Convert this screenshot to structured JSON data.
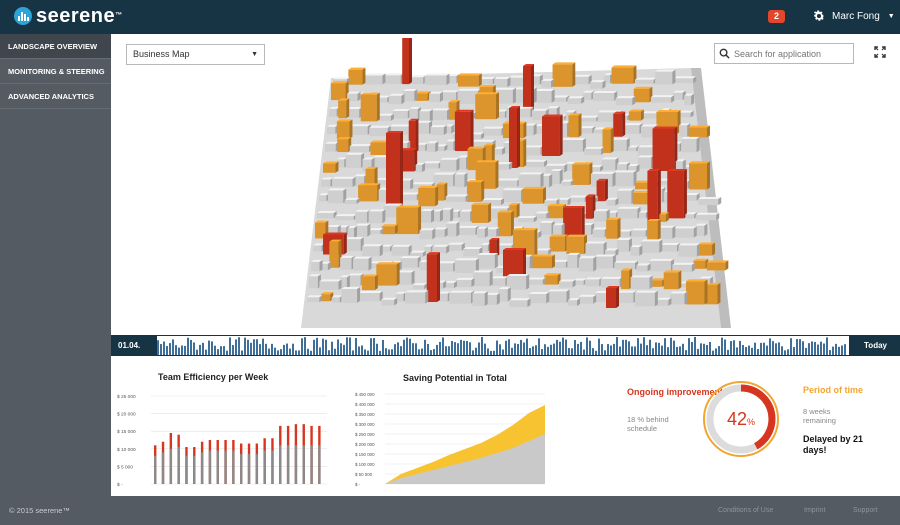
{
  "header": {
    "logo_text": "seerene",
    "logo_tm": "™",
    "notifications": "2",
    "user_name": "Marc Fong",
    "colors": {
      "bar": "#173445",
      "accent": "#2ea3d6",
      "badge": "#e4462b"
    }
  },
  "sidebar": {
    "items": [
      {
        "label": "LANDSCAPE OVERVIEW"
      },
      {
        "label": "MONITORING & STEERING"
      },
      {
        "label": "ADVANCED ANALYTICS"
      }
    ]
  },
  "map": {
    "view_selector": "Business Map",
    "search_placeholder": "Search for application",
    "colors": {
      "orange": "#f3a531",
      "red": "#d6361f",
      "building": "#e6e6e6"
    }
  },
  "timeline": {
    "start_label": "01.04.",
    "end_label": "Today"
  },
  "team_efficiency": {
    "title": "Team Efficiency per Week",
    "chart_data": {
      "type": "bar",
      "yticks": [
        "$ 25 000",
        "$ 20 000",
        "$ 15 000",
        "$ 10 000",
        "$ 5 000",
        "$ -"
      ],
      "ylim": [
        0,
        25000
      ],
      "series": [
        {
          "values": [
            11000,
            12000,
            14500,
            14000,
            10500,
            10500,
            12000,
            12500,
            12500,
            12500,
            12500,
            11500,
            11500,
            11500,
            13000,
            13000,
            16500,
            16500,
            17000,
            17000,
            16500,
            16500
          ]
        },
        {
          "values": [
            8000,
            9000,
            10000,
            10500,
            8000,
            8000,
            9000,
            9500,
            9500,
            9500,
            9500,
            8500,
            8500,
            8500,
            9500,
            9500,
            11000,
            11000,
            11000,
            11000,
            11000,
            11000
          ]
        }
      ]
    }
  },
  "saving_potential": {
    "title": "Saving Potential in Total",
    "chart_data": {
      "type": "area",
      "yticks": [
        "$ 450 000",
        "$ 400 000",
        "$ 350 000",
        "$ 300 000",
        "$ 250 000",
        "$ 200 000",
        "$ 150 000",
        "$ 100 000",
        "$ 50 000",
        "$ -"
      ],
      "ylim": [
        0,
        450000
      ],
      "x": [
        0,
        1,
        2,
        3,
        4,
        5,
        6,
        7,
        8,
        9,
        10
      ],
      "series": [
        {
          "values": [
            0,
            50000,
            80000,
            110000,
            145000,
            175000,
            205000,
            245000,
            295000,
            355000,
            395000
          ]
        },
        {
          "values": [
            0,
            30000,
            50000,
            70000,
            90000,
            110000,
            130000,
            155000,
            180000,
            215000,
            250000
          ]
        }
      ]
    }
  },
  "kpi": {
    "left_title": "Ongoing improvements",
    "left_sub": "18 % behind schedule",
    "value": "42",
    "unit": "%",
    "progress": 0.42,
    "right_title": "Period of time",
    "right_sub": "8 weeks remaining",
    "delay": "Delayed by 21 days!"
  },
  "footer": {
    "copyright": "© 2015  seerene™",
    "links": [
      "Conditions of Use",
      "Imprint",
      "Support"
    ]
  }
}
